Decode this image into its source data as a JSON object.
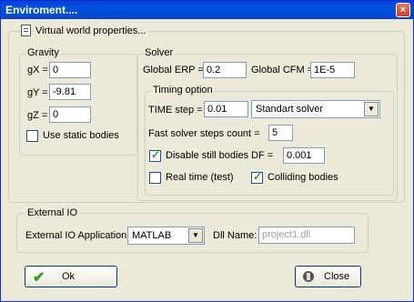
{
  "window": {
    "title": "Enviroment....",
    "close_glyph": "×"
  },
  "main_group": {
    "label": "Virtual world properties..."
  },
  "gravity": {
    "label": "Gravity",
    "gx_label": "gX =",
    "gx_value": "0",
    "gy_label": "gY =",
    "gy_value": "-9.81",
    "gz_label": "gZ =",
    "gz_value": "0",
    "static_bodies_label": "Use static bodies",
    "static_bodies_checked": false
  },
  "solver": {
    "label": "Solver",
    "erp_label": "Global ERP =",
    "erp_value": "0.2",
    "cfm_label": "Global CFM =",
    "cfm_value": "1E-5"
  },
  "timing": {
    "label": "Timing option",
    "time_step_label": "TIME step =",
    "time_step_value": "0.01",
    "solver_type_selected": "Standart solver",
    "fast_steps_label": "Fast solver steps count =",
    "fast_steps_value": "5",
    "disable_still_label": "Disable still bodies",
    "disable_still_checked": true,
    "df_label": "DF =",
    "df_value": "0.001",
    "real_time_label": "Real time (test)",
    "real_time_checked": false,
    "colliding_label": "Colliding bodies",
    "colliding_checked": true
  },
  "external_io": {
    "label": "External IO",
    "app_label": "External IO Application:",
    "app_selected": "MATLAB",
    "dll_label": "Dll Name:",
    "dll_value": "project1.dll"
  },
  "buttons": {
    "ok_label": "Ok",
    "close_label": "Close"
  },
  "colors": {
    "titlebar": "#0052e0",
    "check_mark": "#21a121",
    "ok_icon": "#2aa12a"
  },
  "icons": {
    "ok": "check-icon",
    "close": "stop-icon",
    "group": "page-icon"
  }
}
